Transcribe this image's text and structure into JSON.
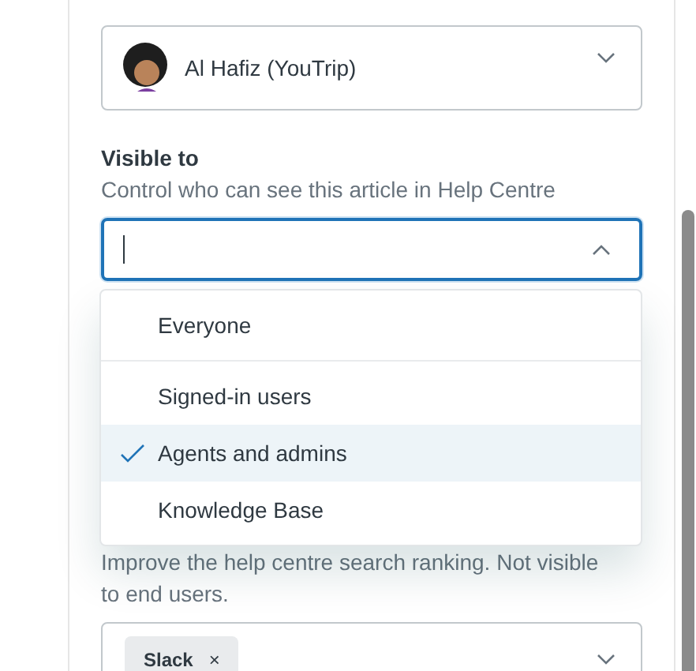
{
  "owner": {
    "name": "Al Hafiz (YouTrip)"
  },
  "visible_to": {
    "label": "Visible to",
    "description": "Control who can see this article in Help Centre",
    "expanded": true,
    "option_groups": [
      [
        {
          "label": "Everyone",
          "selected": false
        }
      ],
      [
        {
          "label": "Signed-in users",
          "selected": false
        },
        {
          "label": "Agents and admins",
          "selected": true
        },
        {
          "label": "Knowledge Base",
          "selected": false
        }
      ]
    ]
  },
  "labels": {
    "description": "Improve the help centre search ranking. Not visible to end users.",
    "tags": [
      {
        "label": "Slack",
        "remove": "×"
      }
    ]
  }
}
